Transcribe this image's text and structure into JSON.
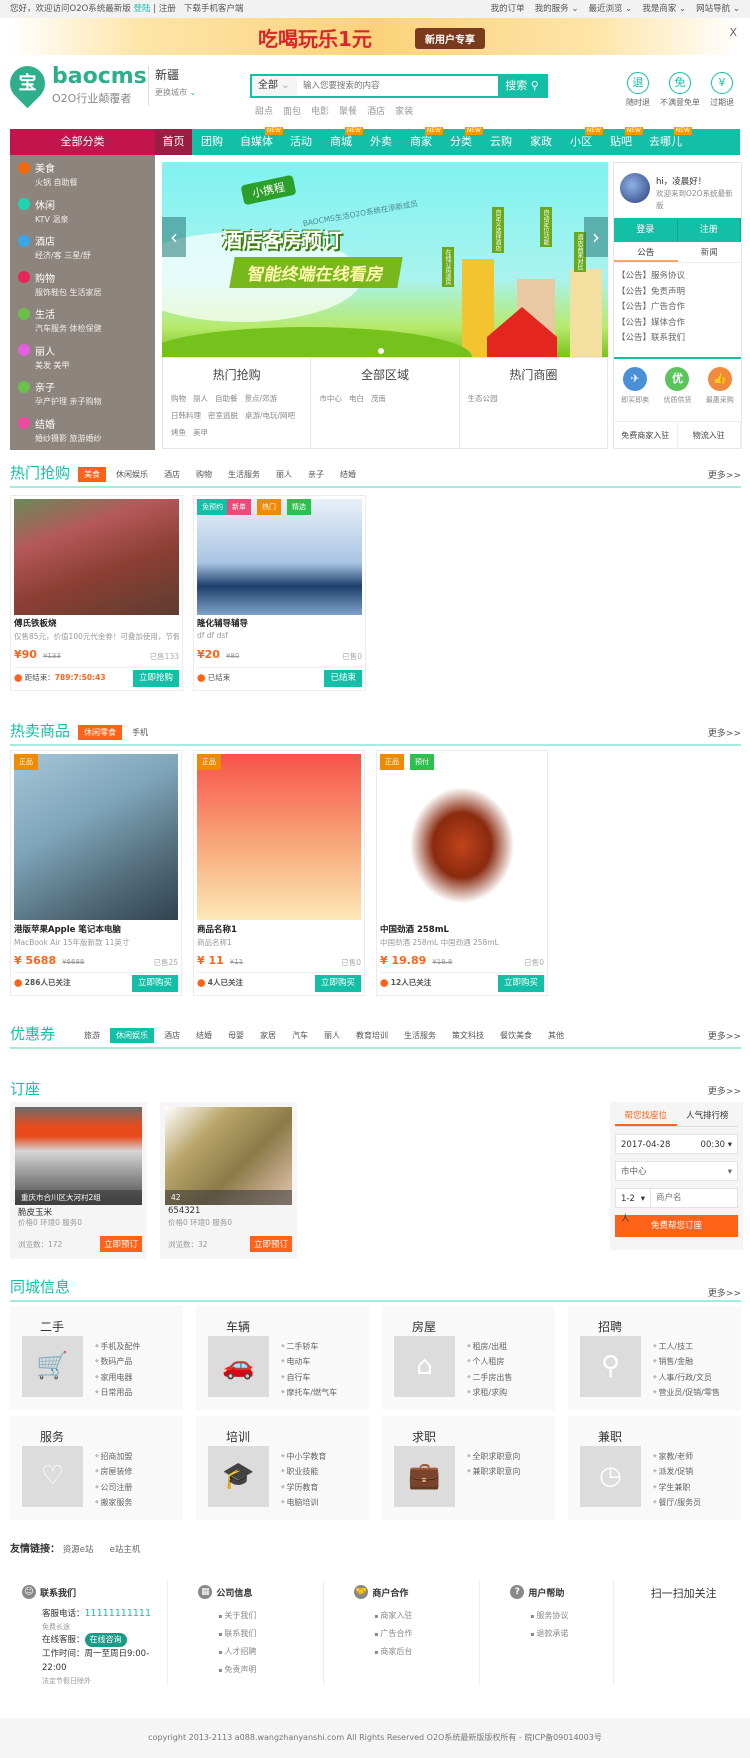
{
  "topbar": {
    "greeting": "您好，欢迎访问O2O系统最新版",
    "login": "登陆",
    "register": "注册",
    "download": "下载手机客户端",
    "right": [
      "我的订单",
      "我的服务",
      "最近浏览",
      "我是商家",
      "网站导航"
    ]
  },
  "ad": {
    "title": "吃喝玩乐1元",
    "badge": "新用户专享",
    "close": "X"
  },
  "header": {
    "logo_char": "宝",
    "brand": "baocms",
    "slogan": "O2O行业颠覆者",
    "city": "新疆",
    "change_city": "更换城市",
    "search_scope": "全部",
    "search_placeholder": "输入您要搜索的内容",
    "search_btn": "搜索",
    "hotwords": [
      "甜点",
      "面包",
      "电影",
      "聚餐",
      "酒店",
      "家装"
    ],
    "guarantees": [
      {
        "icon": "退",
        "label": "随时退"
      },
      {
        "icon": "免",
        "label": "不满意免单"
      },
      {
        "icon": "¥",
        "label": "过期退"
      }
    ]
  },
  "nav": {
    "all": "全部分类",
    "home": "首页",
    "items": [
      {
        "l": "团购"
      },
      {
        "l": "自媒体",
        "n": "NEW"
      },
      {
        "l": "活动"
      },
      {
        "l": "商城",
        "n": "NEW"
      },
      {
        "l": "外卖"
      },
      {
        "l": "商家",
        "n": "NEW"
      },
      {
        "l": "分类",
        "n": "NEW"
      },
      {
        "l": "云购"
      },
      {
        "l": "家政"
      },
      {
        "l": "小区",
        "n": "NEW"
      },
      {
        "l": "贴吧",
        "n": "NEW"
      },
      {
        "l": "去哪儿",
        "n": "NEW"
      }
    ]
  },
  "categories": [
    {
      "name": "美食",
      "sub": "火锅  自助餐",
      "color": "#f0690f"
    },
    {
      "name": "休闲",
      "sub": "KTV  温泉",
      "color": "#22d3b0"
    },
    {
      "name": "酒店",
      "sub": "经济/客  三星/舒",
      "color": "#3aa6e8"
    },
    {
      "name": "购物",
      "sub": "服饰鞋包  生活家居",
      "color": "#e8245d"
    },
    {
      "name": "生活",
      "sub": "汽车服务  体检保健",
      "color": "#6cc04a"
    },
    {
      "name": "丽人",
      "sub": "美发  美甲",
      "color": "#e460e0"
    },
    {
      "name": "亲子",
      "sub": "孕产护理  亲子购物",
      "color": "#6cc04a"
    },
    {
      "name": "结婚",
      "sub": "婚纱摄影  旅游婚纱",
      "color": "#f24aa0"
    }
  ],
  "slider": {
    "ribbon": "小携程",
    "sub": "BAOCMS生活O2O系统在添新成员",
    "title": "酒店客房预订",
    "band": "智能终端在线看房",
    "signs": [
      "在线订房退房",
      "自定义选择酒店",
      "自动定位功能",
      "酒店商家对比"
    ],
    "prev": "‹",
    "next": "›"
  },
  "hotboxes": [
    {
      "title": "热门抢购",
      "links": [
        "购物",
        "丽人",
        "自助餐",
        "景点/郊游",
        "日韩料理",
        "密室逃脱",
        "桌游/电玩/网吧",
        "烤鱼",
        "美甲"
      ]
    },
    {
      "title": "全部区域",
      "links": [
        "市中心",
        "电白",
        "茂南"
      ]
    },
    {
      "title": "热门商圈",
      "links": [
        "生态公园"
      ]
    }
  ],
  "user_panel": {
    "hi": "hi，凌晨好！",
    "welcome": "欢迎来到O2O系统最新版",
    "login": "登录",
    "register": "注册",
    "tabs": [
      "公告",
      "新闻"
    ],
    "notices": [
      "【公告】服务协议",
      "【公告】免责声明",
      "【公告】广告合作",
      "【公告】媒体合作",
      "【公告】联系我们"
    ],
    "icons": [
      {
        "g": "✈",
        "l": "即买即卖",
        "c": "#4a90d9"
      },
      {
        "g": "优",
        "l": "优质供货",
        "c": "#5cc45c"
      },
      {
        "g": "👍",
        "l": "最惠采购",
        "c": "#f08a3c"
      }
    ],
    "bottom": [
      "免费商家入驻",
      "物流入驻"
    ]
  },
  "hot_sale": {
    "title": "热门抢购",
    "tabs": [
      "美食",
      "休闲娱乐",
      "酒店",
      "购物",
      "生活服务",
      "丽人",
      "亲子",
      "结婚"
    ],
    "more": "更多>>",
    "items": [
      {
        "name": "傅氏铁板烧",
        "desc": "仅售85元，价值100元代金券！可叠加使用，节假",
        "price": "¥90",
        "old": "¥133",
        "sold": "已售133",
        "status": "距结束：",
        "countdown": "789:7:50:43",
        "btn": "立即抢购",
        "tags": []
      },
      {
        "name": "隆化辅导辅导",
        "desc": "df df dsf",
        "price": "¥20",
        "old": "¥80",
        "sold": "已售0",
        "status": "已结束",
        "countdown": "",
        "btn": "已结束",
        "tags": [
          "免预约",
          "新单",
          "热门",
          "精选"
        ]
      }
    ]
  },
  "hot_goods": {
    "title": "热卖商品",
    "tabs": [
      "休闲零食",
      "手机"
    ],
    "more": "更多>>",
    "items": [
      {
        "name": "港版苹果Apple 笔记本电脑",
        "desc": "MacBook Air 15年版新款 11英寸",
        "price": "¥ 5688",
        "old": "¥6688",
        "sold": "已售25",
        "follow": "286人已关注",
        "btn": "立即购买",
        "tags": [
          "正品"
        ]
      },
      {
        "name": "商品名称1",
        "desc": "商品名称1",
        "price": "¥ 11",
        "old": "¥11",
        "sold": "已售0",
        "follow": "4人已关注",
        "btn": "立即购买",
        "tags": [
          "正品"
        ]
      },
      {
        "name": "中国劲酒 258mL",
        "desc": "中国劲酒 258mL 中国劲酒 258mL",
        "price": "¥ 19.89",
        "old": "¥19.8",
        "sold": "已售0",
        "follow": "12人已关注",
        "btn": "立即购买",
        "tags": [
          "正品",
          "预付"
        ]
      }
    ]
  },
  "coupons": {
    "title": "优惠券",
    "tabs": [
      "旅游",
      "休闲娱乐",
      "酒店",
      "结婚",
      "母婴",
      "家居",
      "汽车",
      "丽人",
      "教育培训",
      "生活服务",
      "策文科技",
      "餐饮美食",
      "其他"
    ],
    "more": "更多>>"
  },
  "booking": {
    "title": "订座",
    "more": "更多>>",
    "items": [
      {
        "caption": "重庆市合川区大河村2组",
        "name": "脆皮玉米",
        "scores": "价格0  环境0  服务0",
        "views": "浏览数：172",
        "btn": "立即预订"
      },
      {
        "caption": "42",
        "name": "654321",
        "scores": "价格0  环境0  服务0",
        "views": "浏览数：32",
        "btn": "立即预订"
      }
    ],
    "form": {
      "tabs": [
        "帮您找座位",
        "人气排行榜"
      ],
      "date": "2017-04-28",
      "time": "00:30",
      "area": "市中心",
      "people": "1-2人",
      "merchant_placeholder": "商户名",
      "btn": "免费帮您订座"
    }
  },
  "city_info": {
    "title": "同城信息",
    "more": "更多>>",
    "groups": [
      {
        "t": "二手",
        "i": "🛒",
        "l": [
          "手机及配件",
          "数码产品",
          "家用电器",
          "日常用品"
        ]
      },
      {
        "t": "车辆",
        "i": "🚗",
        "l": [
          "二手轿车",
          "电动车",
          "自行车",
          "摩托车/燃气车"
        ]
      },
      {
        "t": "房屋",
        "i": "⌂",
        "l": [
          "租房/出租",
          "个人租房",
          "二手房出售",
          "求租/求购"
        ]
      },
      {
        "t": "招聘",
        "i": "⚲",
        "l": [
          "工人/技工",
          "销售/金融",
          "人事/行政/文员",
          "营业员/促销/零售"
        ]
      },
      {
        "t": "服务",
        "i": "♡",
        "l": [
          "招商加盟",
          "房屋装修",
          "公司注册",
          "搬家服务"
        ]
      },
      {
        "t": "培训",
        "i": "🎓",
        "l": [
          "中小学教育",
          "职业技能",
          "学历教育",
          "电脑培训"
        ]
      },
      {
        "t": "求职",
        "i": "💼",
        "l": [
          "全职求职意向",
          "兼职求职意向"
        ]
      },
      {
        "t": "兼职",
        "i": "◷",
        "l": [
          "家教/老师",
          "派发/促销",
          "学生兼职",
          "餐厅/服务员"
        ]
      }
    ]
  },
  "friends": {
    "label": "友情链接：",
    "links": [
      "资源e站",
      "e站主机"
    ]
  },
  "footer": {
    "contact": {
      "title": "联系我们",
      "phone_label": "客服电话：",
      "phone": "11111111111",
      "free": "免费长途",
      "online_label": "在线客服：",
      "online_btn": "在线咨询",
      "hours": "工作时间：周一至周日9:00-22:00",
      "holiday": "法定节假日除外"
    },
    "cols": [
      {
        "title": "公司信息",
        "icon": "▦",
        "links": [
          "关于我们",
          "联系我们",
          "人才招聘",
          "免责声明"
        ]
      },
      {
        "title": "商户合作",
        "icon": "🤝",
        "links": [
          "商家入驻",
          "广告合作",
          "商家后台"
        ]
      },
      {
        "title": "用户帮助",
        "icon": "?",
        "links": [
          "服务协议",
          "退款承诺"
        ]
      }
    ],
    "qr": "扫一扫加关注",
    "copyright": "copyright 2013-2113 a088.wangzhanyanshi.com All Rights Reserved O2O系统最新版版权所有 - 皖ICP备09014003号"
  },
  "colors": {
    "teal": "#13bfa6",
    "crimson": "#c2154e",
    "orange": "#ff6319"
  }
}
